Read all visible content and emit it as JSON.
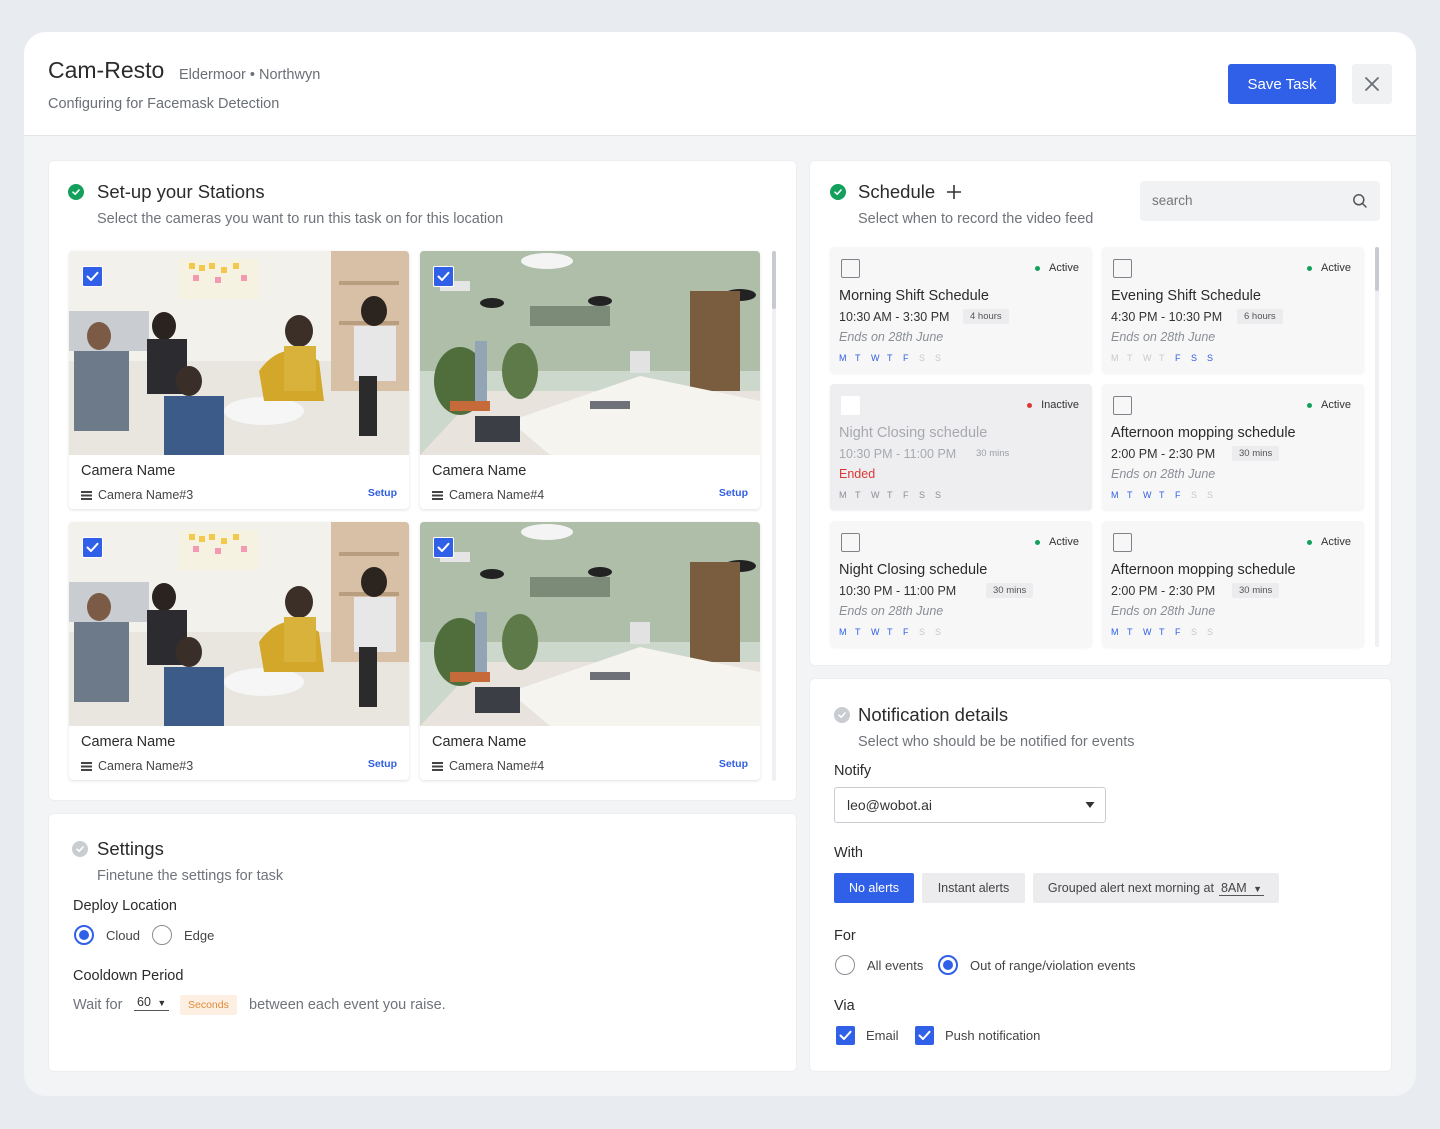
{
  "header": {
    "title": "Cam-Resto",
    "location": "Eldermoor • Northwyn",
    "subtitle": "Configuring for Facemask Detection",
    "save_label": "Save Task"
  },
  "stations": {
    "title": "Set-up your Stations",
    "subtitle": "Select the cameras you want to run this task on for this location",
    "cameras": [
      {
        "name": "Camera Name",
        "sub": "Camera Name#3",
        "setup": "Setup",
        "checked": true,
        "scene": "meeting"
      },
      {
        "name": "Camera Name",
        "sub": "Camera Name#4",
        "setup": "Setup",
        "checked": true,
        "scene": "office"
      },
      {
        "name": "Camera Name",
        "sub": "Camera Name#3",
        "setup": "Setup",
        "checked": true,
        "scene": "meeting"
      },
      {
        "name": "Camera Name",
        "sub": "Camera Name#4",
        "setup": "Setup",
        "checked": true,
        "scene": "office"
      }
    ]
  },
  "settings": {
    "title": "Settings",
    "subtitle": "Finetune the settings for task",
    "deploy_label": "Deploy Location",
    "deploy_options": [
      "Cloud",
      "Edge"
    ],
    "deploy_selected": "Cloud",
    "cooldown_label": "Cooldown Period",
    "wait_for": "Wait for",
    "cooldown_value": "60",
    "cooldown_unit": "Seconds",
    "cooldown_suffix": "between each event you raise."
  },
  "schedule": {
    "title": "Schedule",
    "subtitle": "Select when to record the video feed",
    "search_placeholder": "search",
    "day_letters": [
      "M",
      "T",
      "W",
      "T",
      "F",
      "S",
      "S"
    ],
    "items": [
      {
        "title": "Morning Shift Schedule",
        "time": "10:30 AM - 3:30 PM",
        "duration": "4 hours",
        "end": "Ends on 28th June",
        "status": "Active",
        "days": [
          1,
          1,
          1,
          1,
          1,
          0,
          0
        ],
        "inactive": false
      },
      {
        "title": "Evening Shift Schedule",
        "time": "4:30 PM - 10:30 PM",
        "duration": "6 hours",
        "end": "Ends on 28th June",
        "status": "Active",
        "days": [
          0,
          0,
          0,
          0,
          1,
          1,
          1
        ],
        "inactive": false
      },
      {
        "title": "Night Closing schedule",
        "time": "10:30 PM - 11:00 PM",
        "duration": "30 mins",
        "end": "Ended",
        "status": "Inactive",
        "days": [
          1,
          1,
          1,
          1,
          1,
          1,
          1
        ],
        "inactive": true
      },
      {
        "title": "Afternoon mopping schedule",
        "time": "2:00 PM - 2:30 PM",
        "duration": "30 mins",
        "end": "Ends on 28th June",
        "status": "Active",
        "days": [
          1,
          1,
          1,
          1,
          1,
          0,
          0
        ],
        "inactive": false
      },
      {
        "title": "Night Closing schedule",
        "time": "10:30 PM - 11:00 PM",
        "duration": "30 mins",
        "end": "Ends on 28th June",
        "status": "Active",
        "days": [
          1,
          1,
          1,
          1,
          1,
          0,
          0
        ],
        "inactive": false
      },
      {
        "title": "Afternoon mopping schedule",
        "time": "2:00 PM - 2:30 PM",
        "duration": "30 mins",
        "end": "Ends on 28th June",
        "status": "Active",
        "days": [
          1,
          1,
          1,
          1,
          1,
          0,
          0
        ],
        "inactive": false
      }
    ]
  },
  "notification": {
    "title": "Notification details",
    "subtitle": "Select who should be be notified for events",
    "notify_label": "Notify",
    "notify_value": "leo@wobot.ai",
    "with_label": "With",
    "with_options": [
      "No alerts",
      "Instant alerts",
      "Grouped alert next morning at"
    ],
    "with_selected": "No alerts",
    "grouped_time": "8AM",
    "for_label": "For",
    "for_options": [
      "All events",
      "Out of range/violation events"
    ],
    "for_selected": "Out of range/violation events",
    "via_label": "Via",
    "via_options": [
      "Email",
      "Push notification"
    ]
  },
  "colors": {
    "accent": "#3160e8",
    "success": "#12a05c",
    "danger": "#d93838",
    "seconds_bg": "#fdf0e2"
  }
}
